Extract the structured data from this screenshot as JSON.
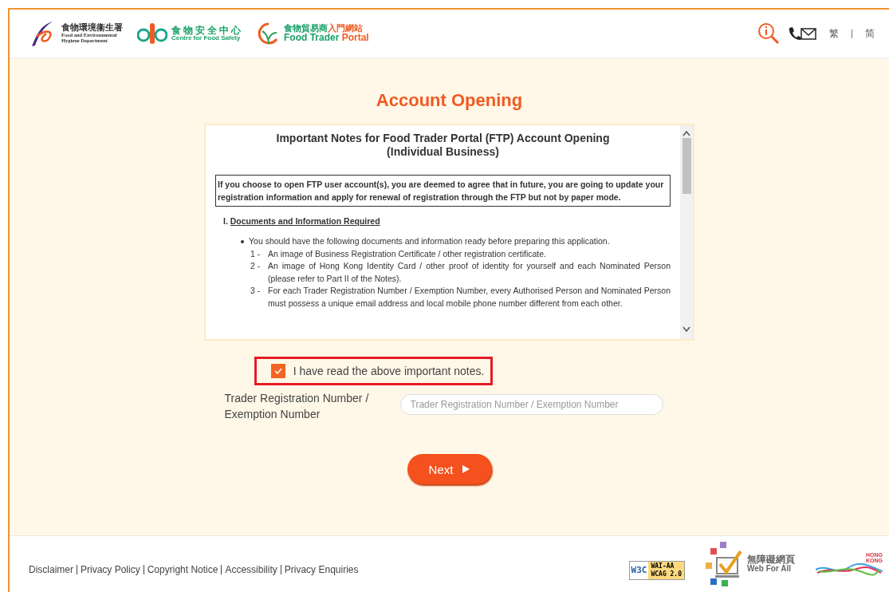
{
  "header": {
    "logos": [
      {
        "kind": "fehd",
        "chinese": "食物環境衞生署",
        "english": [
          "Food and Environmental",
          "Hygiene Department"
        ]
      },
      {
        "kind": "cfs",
        "chinese": "食物安全中心",
        "english": [
          "Centre for Food Safety"
        ]
      },
      {
        "kind": "ftp",
        "chinese": "食物貿易商",
        "chinese_accent": "入門網站",
        "english": [
          "Food Trader",
          "Portal"
        ]
      }
    ],
    "languages": [
      "繁",
      "简"
    ]
  },
  "title": "Account Opening",
  "notes": {
    "heading": [
      "Important Notes for Food Trader Portal (FTP) Account Opening",
      "(Individual Business)"
    ],
    "statement": "If you choose to open FTP user account(s), you are deemed to agree that in future, you are going to update your registration information and apply for renewal of registration through the FTP but not by paper mode.",
    "section_number": "I.",
    "section_title": "Documents and Information Required",
    "bullet": "You should have the following documents and information ready before preparing this application.",
    "items": [
      {
        "number": "1 -",
        "text": "An image of Business Registration Certificate / other registration certificate."
      },
      {
        "number": "2 -",
        "text": "An image of Hong Kong Identity Card / other proof of identity for yourself and each Nominated Person (please refer to Part II of the Notes)."
      },
      {
        "number": "3 -",
        "text": "For each Trader Registration Number / Exemption Number, every Authorised Person and Nominated Person must possess a unique email address and local mobile phone number different from each other."
      }
    ]
  },
  "agree": {
    "label": "I have read the above important notes.",
    "checked": true,
    "highlighted": true
  },
  "field": {
    "label": "Trader Registration Number / Exemption Number",
    "placeholder": "Trader Registration Number / Exemption Number"
  },
  "next_button": "Next",
  "footer": {
    "links": [
      "Disclaimer",
      "Privacy Policy",
      "Copyright Notice",
      "Accessibility",
      "Privacy Enquiries"
    ],
    "badges": [
      {
        "kind": "w3c",
        "texts": [
          "W3C",
          "WAI-AA",
          "WCAG 2.0"
        ]
      },
      {
        "kind": "webforall",
        "texts": [
          "無障礙網頁",
          "Web For All"
        ]
      },
      {
        "kind": "hongkong",
        "texts": [
          "HONG",
          "KONG"
        ]
      }
    ]
  }
}
